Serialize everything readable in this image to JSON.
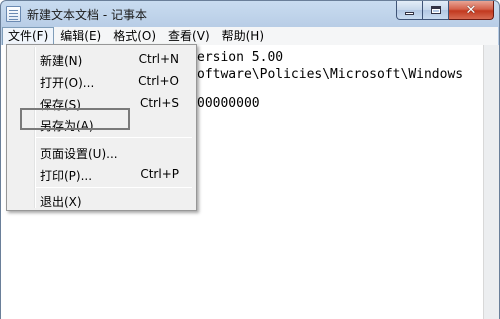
{
  "window": {
    "title": "新建文本文档 - 记事本"
  },
  "menubar": {
    "items": [
      {
        "label": "文件(F)"
      },
      {
        "label": "编辑(E)"
      },
      {
        "label": "格式(O)"
      },
      {
        "label": "查看(V)"
      },
      {
        "label": "帮助(H)"
      }
    ]
  },
  "editor": {
    "lines": [
      "Windows Registry Editor Version 5.00",
      "[HKEY_CURRENT_USER\\Software\\Policies\\Microsoft\\Windows",
      "\"NoDrives\"=dword:00000000"
    ],
    "visible_fragments": [
      "ersion 5.00",
      "oftware\\Policies\\Microsoft\\Windows",
      "00000000"
    ]
  },
  "file_menu": {
    "items": [
      {
        "label": "新建(N)",
        "shortcut": "Ctrl+N"
      },
      {
        "label": "打开(O)...",
        "shortcut": "Ctrl+O"
      },
      {
        "label": "保存(S)",
        "shortcut": "Ctrl+S"
      },
      {
        "label": "另存为(A)...",
        "shortcut": ""
      },
      {
        "label": "页面设置(U)...",
        "shortcut": ""
      },
      {
        "label": "打印(P)...",
        "shortcut": "Ctrl+P"
      },
      {
        "label": "退出(X)",
        "shortcut": ""
      }
    ]
  },
  "colors": {
    "title_bar": "#c9dcf0",
    "close_button": "#c2391f",
    "highlight_border": "#7a7a7a"
  }
}
